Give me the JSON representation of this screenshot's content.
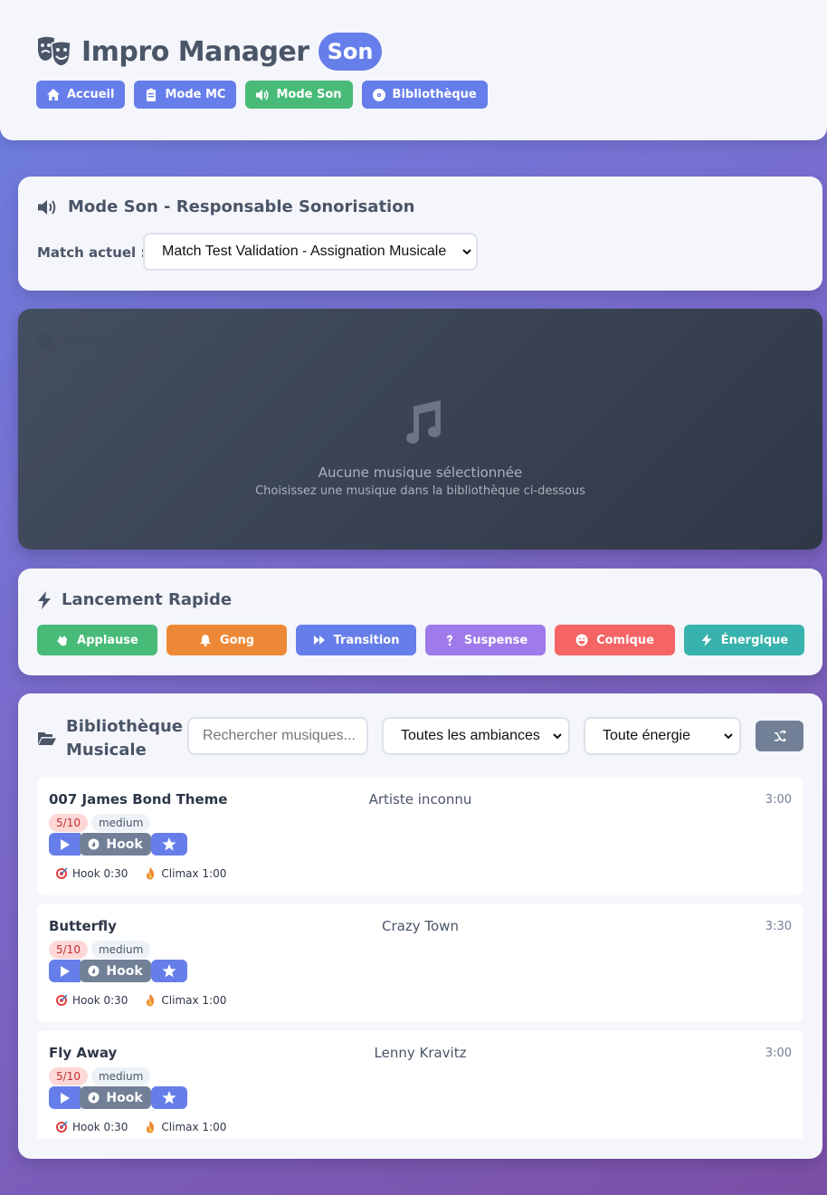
{
  "header": {
    "app_title": "Impro Manager",
    "mode_badge": "Son",
    "nav": [
      {
        "label": "Accueil",
        "icon": "home-icon"
      },
      {
        "label": "Mode MC",
        "icon": "clipboard-icon"
      },
      {
        "label": "Mode Son",
        "icon": "volume-icon",
        "active": true
      },
      {
        "label": "Bibliothèque",
        "icon": "disc-icon"
      }
    ]
  },
  "mode_section": {
    "title": "Mode Son - Responsable Sonorisation",
    "match_label": "Match actuel :",
    "match_selected": "Match Test Validation - Assignation Musicale"
  },
  "player": {
    "title": "Lecteur Principal",
    "empty_title": "Aucune musique sélectionnée",
    "empty_hint": "Choisissez une musique dans la bibliothèque ci-dessous"
  },
  "quick_launch": {
    "title": "Lancement Rapide",
    "buttons": [
      {
        "label": "Applause",
        "icon": "clap-icon",
        "color": "#48bb78"
      },
      {
        "label": "Gong",
        "icon": "bell-icon",
        "color": "#ed8936"
      },
      {
        "label": "Transition",
        "icon": "fast-forward-icon",
        "color": "#667eea"
      },
      {
        "label": "Suspense",
        "icon": "question-icon",
        "color": "#9f7aea"
      },
      {
        "label": "Comique",
        "icon": "laugh-icon",
        "color": "#f56565"
      },
      {
        "label": "Énergique",
        "icon": "bolt-icon",
        "color": "#38b2ac"
      }
    ]
  },
  "library": {
    "title": "Bibliothèque Musicale",
    "search_placeholder": "Rechercher musiques...",
    "mood_filter": "Toutes les ambiances",
    "energy_filter": "Toute énergie",
    "tracks": [
      {
        "title": "007 James Bond Theme",
        "artist": "Artiste inconnu",
        "duration": "3:00",
        "energy": "5/10",
        "level": "medium",
        "hook_label": "Hook",
        "hook_marker": "Hook 0:30",
        "climax_marker": "Climax 1:00"
      },
      {
        "title": "Butterfly",
        "artist": "Crazy Town",
        "duration": "3:30",
        "energy": "5/10",
        "level": "medium",
        "hook_label": "Hook",
        "hook_marker": "Hook 0:30",
        "climax_marker": "Climax 1:00"
      },
      {
        "title": "Fly Away",
        "artist": "Lenny Kravitz",
        "duration": "3:00",
        "energy": "5/10",
        "level": "medium",
        "hook_label": "Hook",
        "hook_marker": "Hook 0:30",
        "climax_marker": "Climax 1:00"
      }
    ]
  },
  "colors": {
    "primary": "#667eea",
    "success": "#48bb78",
    "muted": "#718096"
  }
}
